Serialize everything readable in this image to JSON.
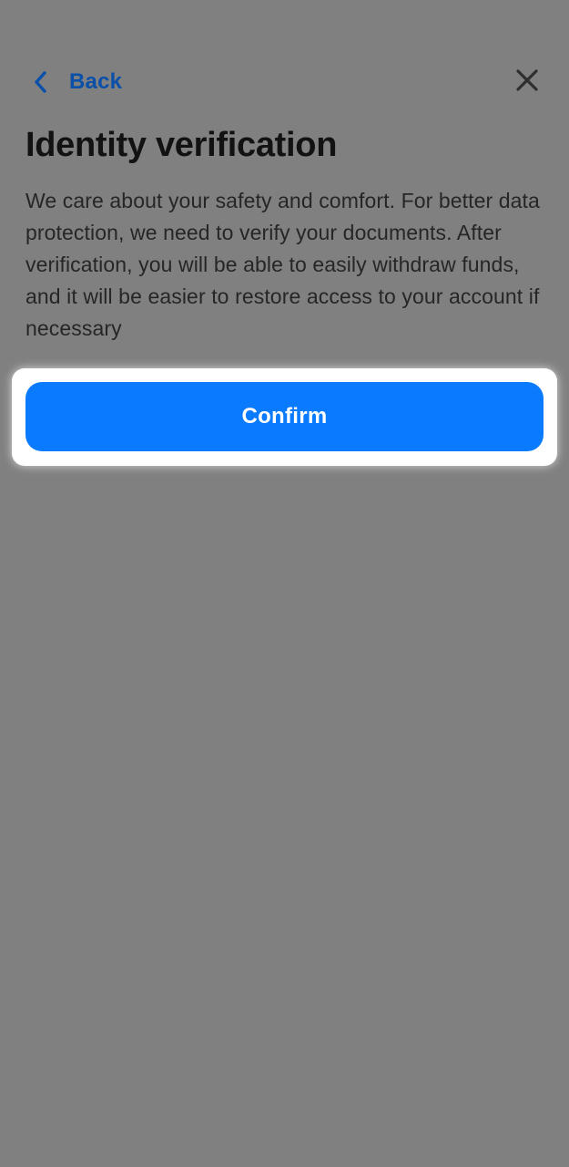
{
  "nav": {
    "back_label": "Back",
    "back_icon": "chevron-left-icon",
    "close_icon": "close-icon"
  },
  "content": {
    "title": "Identity verification",
    "description": "We care about your safety and comfort. For better data protection, we need to verify your documents. After verification, you will be able to easily withdraw funds, and it will be easier to restore access to your account if necessary"
  },
  "actions": {
    "confirm_label": "Confirm"
  },
  "colors": {
    "overlay": "#808080",
    "accent": "#0a7aff",
    "back_link": "#0a4fa8",
    "highlight": "#ffffff"
  }
}
